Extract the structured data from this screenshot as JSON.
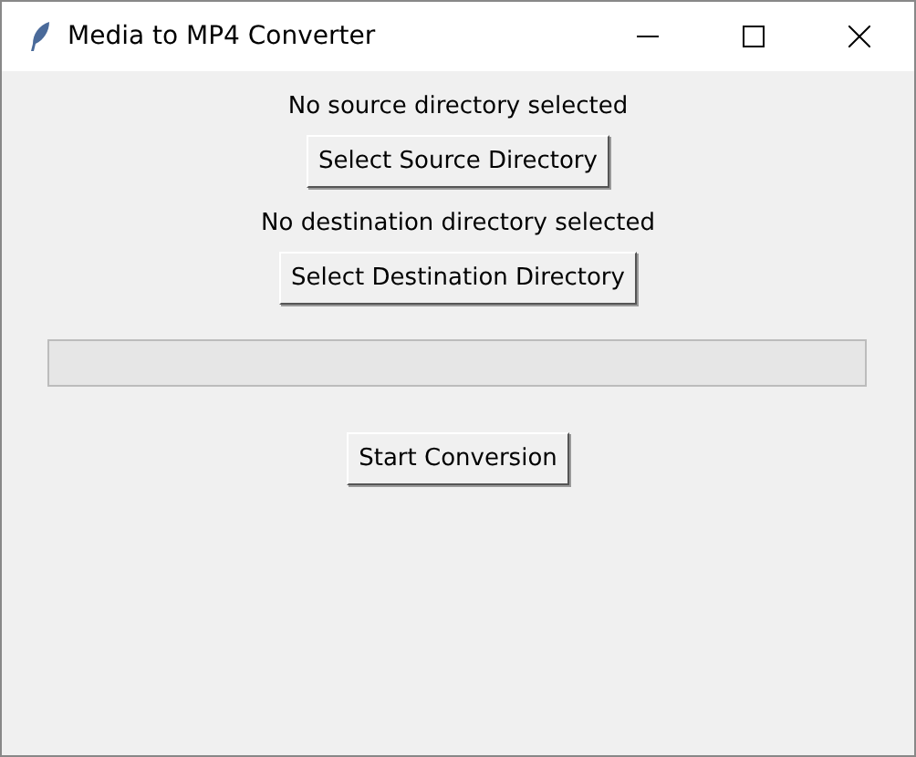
{
  "window": {
    "title": "Media to MP4 Converter"
  },
  "source": {
    "status": "No source directory selected",
    "button": "Select Source Directory"
  },
  "destination": {
    "status": "No destination directory selected",
    "button": "Select Destination Directory"
  },
  "progress": {
    "level": 0
  },
  "start_button": "Start Conversion"
}
